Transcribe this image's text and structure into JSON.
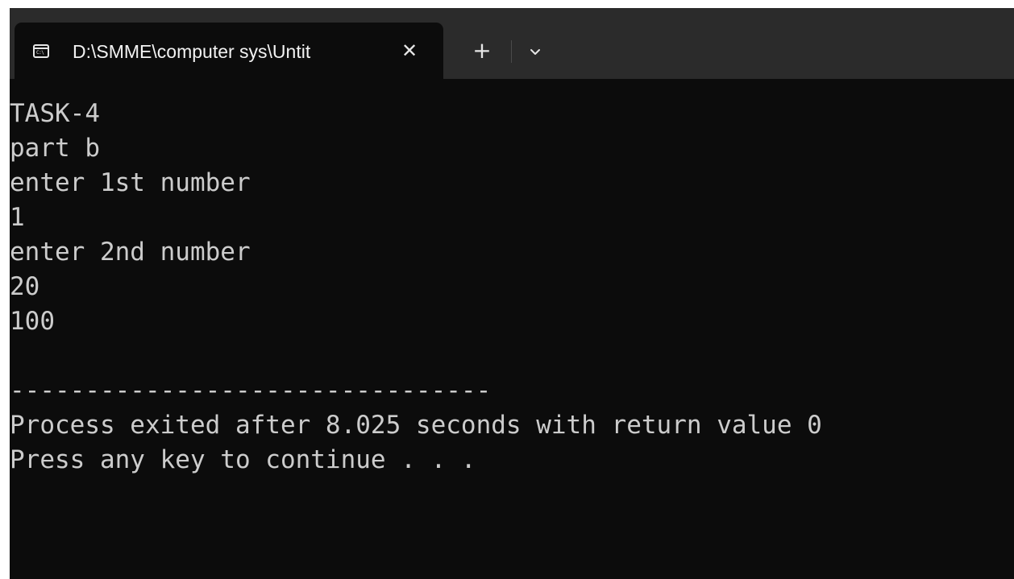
{
  "tab": {
    "title": "D:\\SMME\\computer sys\\Untit",
    "icon": "console-icon",
    "icon_glyph": "C:\\",
    "close_glyph": "✕"
  },
  "toolbar": {
    "new_tab_glyph": "+",
    "dropdown_icon": "chevron-down-icon"
  },
  "console": {
    "lines": [
      "TASK-4",
      "part b",
      "enter 1st number",
      "1",
      "enter 2nd number",
      "20",
      "100",
      "",
      "--------------------------------",
      "Process exited after 8.025 seconds with return value 0",
      "Press any key to continue . . ."
    ]
  },
  "colors": {
    "titlebar": "#2b2b2b",
    "console_bg": "#0c0c0c",
    "console_text": "#cccccc"
  }
}
